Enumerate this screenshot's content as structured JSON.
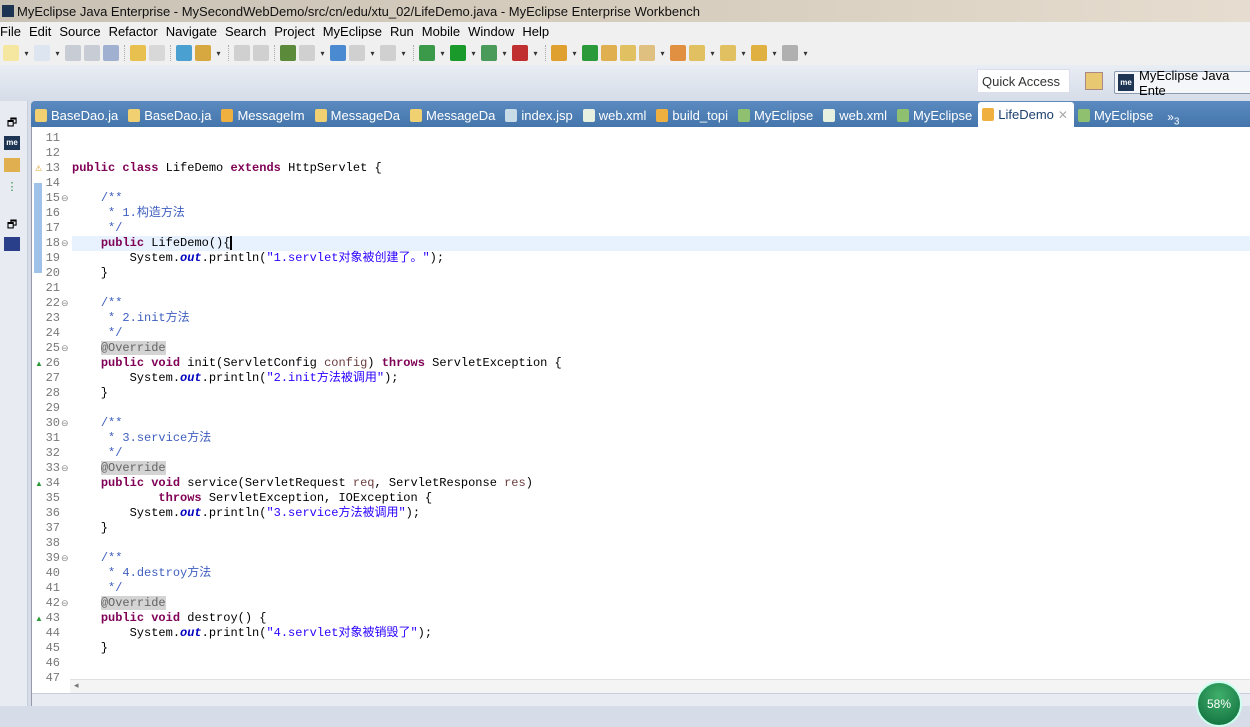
{
  "window": {
    "title": "MyEclipse Java Enterprise - MySecondWebDemo/src/cn/edu/xtu_02/LifeDemo.java - MyEclipse Enterprise Workbench",
    "logo": "me"
  },
  "menu": [
    "File",
    "Edit",
    "Source",
    "Refactor",
    "Navigate",
    "Search",
    "Project",
    "MyEclipse",
    "Run",
    "Mobile",
    "Window",
    "Help"
  ],
  "quick_access": {
    "placeholder": "Quick Access"
  },
  "perspective": {
    "logo": "me",
    "label": "MyEclipse Java Ente"
  },
  "tabs": [
    {
      "label": "BaseDao.ja",
      "icon": "java-file-icon",
      "color": "#f0d070"
    },
    {
      "label": "BaseDao.ja",
      "icon": "java-file-icon",
      "color": "#f0d070"
    },
    {
      "label": "MessageIm",
      "icon": "java-file-warning-icon",
      "color": "#f0b040"
    },
    {
      "label": "MessageDa",
      "icon": "java-file-icon",
      "color": "#f0d070"
    },
    {
      "label": "MessageDa",
      "icon": "java-file-icon",
      "color": "#f0d070"
    },
    {
      "label": "index.jsp",
      "icon": "jsp-file-icon",
      "color": "#c8dce8"
    },
    {
      "label": "web.xml",
      "icon": "xml-file-icon",
      "color": "#e8f0e0"
    },
    {
      "label": "build_topi",
      "icon": "java-file-warning-icon",
      "color": "#f0b040"
    },
    {
      "label": "MyEclipse",
      "icon": "browser-icon",
      "color": "#8fc070"
    },
    {
      "label": "web.xml",
      "icon": "xml-file-icon",
      "color": "#e8f0e0"
    },
    {
      "label": "MyEclipse",
      "icon": "browser-icon",
      "color": "#8fc070"
    },
    {
      "label": "LifeDemo",
      "icon": "java-file-warning-icon",
      "color": "#f0b040",
      "active": true
    },
    {
      "label": "MyEclipse",
      "icon": "browser-icon",
      "color": "#8fc070"
    }
  ],
  "tabs_overflow": {
    "symbol": "»",
    "count": "3"
  },
  "editor": {
    "first_line": 11,
    "current_line": 18,
    "lines": [
      [],
      [],
      [
        [
          "kw",
          "public"
        ],
        [
          "pl",
          " "
        ],
        [
          "kw",
          "class"
        ],
        [
          "pl",
          " LifeDemo "
        ],
        [
          "kw",
          "extends"
        ],
        [
          "pl",
          " HttpServlet {"
        ]
      ],
      [],
      [
        [
          "pl",
          "    "
        ],
        [
          "cm",
          "/**"
        ]
      ],
      [
        [
          "pl",
          "    "
        ],
        [
          "cm",
          " * 1.构造方法"
        ]
      ],
      [
        [
          "pl",
          "    "
        ],
        [
          "cm",
          " */"
        ]
      ],
      [
        [
          "pl",
          "    "
        ],
        [
          "kw",
          "public"
        ],
        [
          "pl",
          " LifeDemo(){"
        ]
      ],
      [
        [
          "pl",
          "        System."
        ],
        [
          "fi",
          "out"
        ],
        [
          "pl",
          ".println("
        ],
        [
          "st",
          "\"1.servlet对象被创建了。\""
        ],
        [
          "pl",
          ");"
        ]
      ],
      [
        [
          "pl",
          "    }"
        ]
      ],
      [],
      [
        [
          "pl",
          "    "
        ],
        [
          "cm",
          "/**"
        ]
      ],
      [
        [
          "pl",
          "    "
        ],
        [
          "cm",
          " * 2.init方法"
        ]
      ],
      [
        [
          "pl",
          "    "
        ],
        [
          "cm",
          " */"
        ]
      ],
      [
        [
          "pl",
          "    "
        ],
        [
          "an",
          "@Override"
        ]
      ],
      [
        [
          "pl",
          "    "
        ],
        [
          "kw",
          "public"
        ],
        [
          "pl",
          " "
        ],
        [
          "kw",
          "void"
        ],
        [
          "pl",
          " init(ServletConfig "
        ],
        [
          "pa",
          "config"
        ],
        [
          "pl",
          ") "
        ],
        [
          "kw",
          "throws"
        ],
        [
          "pl",
          " ServletException {"
        ]
      ],
      [
        [
          "pl",
          "        System."
        ],
        [
          "fi",
          "out"
        ],
        [
          "pl",
          ".println("
        ],
        [
          "st",
          "\"2.init方法被调用\""
        ],
        [
          "pl",
          ");"
        ]
      ],
      [
        [
          "pl",
          "    }"
        ]
      ],
      [],
      [
        [
          "pl",
          "    "
        ],
        [
          "cm",
          "/**"
        ]
      ],
      [
        [
          "pl",
          "    "
        ],
        [
          "cm",
          " * 3.service方法"
        ]
      ],
      [
        [
          "pl",
          "    "
        ],
        [
          "cm",
          " */"
        ]
      ],
      [
        [
          "pl",
          "    "
        ],
        [
          "an",
          "@Override"
        ]
      ],
      [
        [
          "pl",
          "    "
        ],
        [
          "kw",
          "public"
        ],
        [
          "pl",
          " "
        ],
        [
          "kw",
          "void"
        ],
        [
          "pl",
          " service(ServletRequest "
        ],
        [
          "pa",
          "req"
        ],
        [
          "pl",
          ", ServletResponse "
        ],
        [
          "pa",
          "res"
        ],
        [
          "pl",
          ")"
        ]
      ],
      [
        [
          "pl",
          "            "
        ],
        [
          "kw",
          "throws"
        ],
        [
          "pl",
          " ServletException, IOException {"
        ]
      ],
      [
        [
          "pl",
          "        System."
        ],
        [
          "fi",
          "out"
        ],
        [
          "pl",
          ".println("
        ],
        [
          "st",
          "\"3.service方法被调用\""
        ],
        [
          "pl",
          ");"
        ]
      ],
      [
        [
          "pl",
          "    }"
        ]
      ],
      [],
      [
        [
          "pl",
          "    "
        ],
        [
          "cm",
          "/**"
        ]
      ],
      [
        [
          "pl",
          "    "
        ],
        [
          "cm",
          " * 4.destroy方法"
        ]
      ],
      [
        [
          "pl",
          "    "
        ],
        [
          "cm",
          " */"
        ]
      ],
      [
        [
          "pl",
          "    "
        ],
        [
          "an",
          "@Override"
        ]
      ],
      [
        [
          "pl",
          "    "
        ],
        [
          "kw",
          "public"
        ],
        [
          "pl",
          " "
        ],
        [
          "kw",
          "void"
        ],
        [
          "pl",
          " destroy() {"
        ]
      ],
      [
        [
          "pl",
          "        System."
        ],
        [
          "fi",
          "out"
        ],
        [
          "pl",
          ".println("
        ],
        [
          "st",
          "\"4.servlet对象被销毁了\""
        ],
        [
          "pl",
          ");"
        ]
      ],
      [
        [
          "pl",
          "    }"
        ]
      ],
      [],
      []
    ],
    "fold_lines": [
      15,
      18,
      22,
      25,
      30,
      33,
      39,
      42
    ],
    "override_lines": [
      26,
      34,
      43
    ]
  },
  "progress_badge": {
    "value": "58%"
  }
}
